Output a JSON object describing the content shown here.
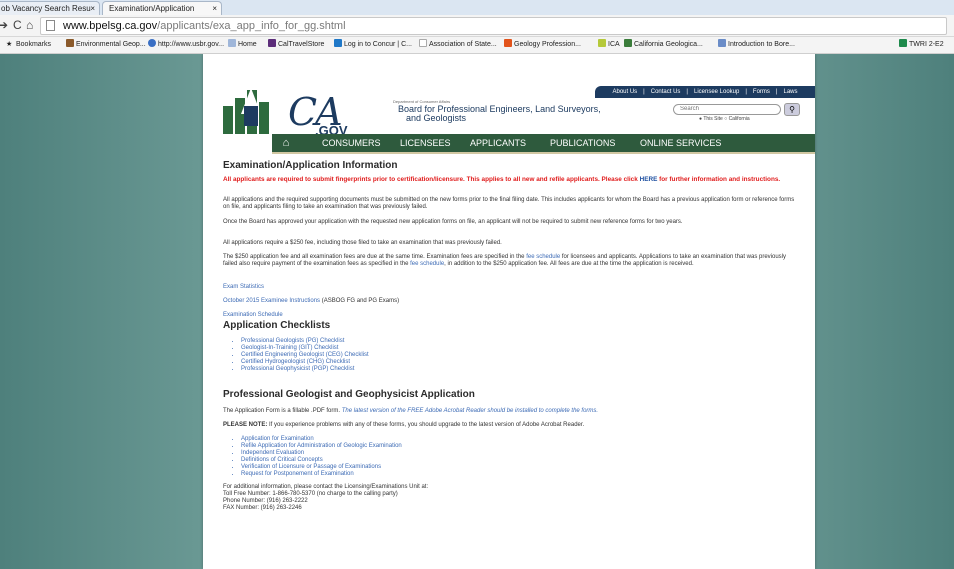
{
  "browser": {
    "tabs": [
      {
        "label": "ob Vacancy Search Resu",
        "close": "×"
      },
      {
        "label": "Examination/Application",
        "close": "×"
      }
    ],
    "url_host": "www.bpelsg.ca.gov",
    "url_path": "/applicants/exa_app_info_for_gg.shtml",
    "bookmarks": [
      "Bookmarks",
      "Environmental Geop...",
      "http://www.usbr.gov...",
      "Home",
      "CalTravelStore",
      "Log in to Concur | C...",
      "Association of State...",
      "Geology Profession...",
      "ICA",
      "California Geologica...",
      "Introduction to Bore...",
      "TWRI 2-E2"
    ]
  },
  "site": {
    "top_links": [
      "About Us",
      "|",
      "Contact Us",
      "|",
      "Licensee Lookup",
      "|",
      "Forms",
      "|",
      "Laws"
    ],
    "cagov": "CA",
    "gov": ".GOV",
    "dept": "Department of Consumer Affairs",
    "board_line1": "Board for Professional Engineers, Land Surveyors,",
    "board_line2": "and Geologists",
    "search_placeholder": "Search",
    "scope": "● This Site   ○ California",
    "nav": [
      "CONSUMERS",
      "LICENSEES",
      "APPLICANTS",
      "PUBLICATIONS",
      "ONLINE SERVICES"
    ]
  },
  "content": {
    "title": "Examination/Application Information",
    "alert_text": "All applicants are required to submit fingerprints prior to certification/licensure. This applies to all new and refile applicants. Please click ",
    "alert_link": "HERE",
    "alert_tail": " for further information and instructions.",
    "p1": "All applications and the required supporting documents must be submitted on the new forms prior to the final filing date. This includes applicants for whom the Board has a previous application form or reference forms on file, and applicants filing to take an examination that was previously failed.",
    "p2": "Once the Board has approved your application with the requested new application forms on file, an applicant will not be required to submit new reference forms for two years.",
    "p3": "All applications require a $250 fee, including those filed to take an examination that was previously failed.",
    "p4a": "The $250 application fee and all examination fees are due at the same time. Examination fees are specified in the ",
    "p4_link1": "fee schedule",
    "p4b": " for licensees and applicants. Applications to take an examination that was previously failed also require payment of the examination fees as specified in the ",
    "p4_link2": "fee schedule",
    "p4c": ", in addition to the $250 application fee. All fees are due at the time the application is received.",
    "link_stats": "Exam Statistics",
    "link_october": "October 2015 Examinee Instructions",
    "link_october_tail": " (ASBOG FG and PG Exams)",
    "link_schedule": "Examination Schedule",
    "checklists_title": "Application Checklists",
    "checklists": [
      "Professional Geologists (PG) Checklist",
      "Geologist-In-Training (GIT) Checklist",
      "Certified Engineering Geologist (CEG) Checklist",
      "Certified Hydrogeologist (CHG) Checklist",
      "Professional Geophysicist (PGP) Checklist"
    ],
    "pg_title": "Professional Geologist and Geophysicist Application",
    "pg_p1a": "The Application Form is a fillable .PDF form. ",
    "pg_p1b": "The latest version of the FREE Adobe Acrobat Reader should be installed to complete the forms.",
    "pg_note_label": "PLEASE NOTE:",
    "pg_note": " If you experience problems with any of these forms, you should upgrade to the latest version of Adobe Acrobat Reader.",
    "forms": [
      "Application for Examination",
      "Refile Application for Administration of Geologic Examination",
      "Independent Evaluation",
      "Definitions of Critical Concepts",
      "Verification of Licensure or Passage of Examinations",
      "Request for Postponement of Examination"
    ],
    "contact1": "For additional information, please contact the Licensing/Examinations Unit at:",
    "contact2": "Toll Free Number: 1-866-780-5370 (no charge to the calling party)",
    "contact3": "Phone Number: (916) 263-2222",
    "contact4": "FAX Number: (916) 263-2246"
  }
}
